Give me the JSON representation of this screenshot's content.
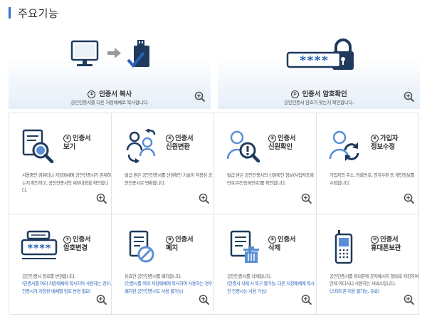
{
  "page": {
    "title": "주요기능"
  },
  "top_features": [
    {
      "number": "①",
      "title": "인증서 복사",
      "description": "공인인증서를 다른 저장매체로 복사합니다."
    },
    {
      "number": "②",
      "title": "인증서 암호확인",
      "description": "공인인증서 암호가 맞는지 확인합니다.",
      "password_mask": "****"
    }
  ],
  "features": [
    {
      "number": "③",
      "title_line1": "인증서",
      "title_line2": "보기",
      "description": "사용중인 컴퓨터나 저장매체에 공인인증서가 존재하는지 확인하고, 공인인증서의 세부내용을 확인합니다.",
      "note": ""
    },
    {
      "number": "④",
      "title_line1": "인증서",
      "title_line2": "신원변환",
      "description": "발급 받은 공인인증서를 신원확인 기술이 적용된 공인인증서로 변환합니다.",
      "note": ""
    },
    {
      "number": "⑤",
      "title_line1": "인증서",
      "title_line2": "신원확인",
      "description": "발급 받은 공인인증서의 신원확인 정보(사업자등록번호/주민등록번호)를 확인합니다.",
      "note": ""
    },
    {
      "number": "⑥",
      "title_line1": "가입자",
      "title_line2": "정보수정",
      "description": "가입자의 주소, 전화번호, 전자우편 등 개인정보를 수정합니다.",
      "note": ""
    },
    {
      "number": "⑦",
      "title_line1": "인증서",
      "title_line2": "암호변경",
      "description": "공인인증서 암호를 변경합니다.",
      "note": "(인증서를 여러 저장매체에 복사하여 사용하는 경우, 인증서가 저장된 매체별 암호 변경 필요)",
      "password_mask": "****"
    },
    {
      "number": "⑧",
      "title_line1": "인증서",
      "title_line2": "폐지",
      "description": "유효한 공인인증서를 폐지합니다.",
      "note": "(인증서를 여러 저장매체에 복사하여 사용하는 경우 폐지된 공인인증서도 사용 불가능)"
    },
    {
      "number": "⑨",
      "title_line1": "인증서",
      "title_line2": "삭제",
      "description": "공인인증서를 삭제합니다.",
      "note": "(인증서 삭제 시 복구 불가능. 다른 저장매체에 복사한 인증서는 사용 가능)"
    },
    {
      "number": "⑩",
      "title_line1": "인증서",
      "title_line2": "휴대폰보관",
      "description": "공인인증서를 휴대폰에 문자메시지 형태로 저장하여 언제 어디서나 사용하는 서비스입니다.",
      "note": "(스마트폰 이용 불가능, 유료)"
    }
  ],
  "colors": {
    "accent": "#2a73c9",
    "icon_dark": "#1f3a5c",
    "icon_blue": "#2a63b8",
    "note_blue": "#2a63b8",
    "border": "#dfe4ea"
  },
  "icons": {
    "zoom": "zoom-in-icon",
    "feature_icons": [
      "certificate-view-icon",
      "identity-convert-icon",
      "identity-check-icon",
      "user-update-icon",
      "password-change-icon",
      "revoke-icon",
      "delete-icon",
      "mobile-storage-icon"
    ]
  }
}
